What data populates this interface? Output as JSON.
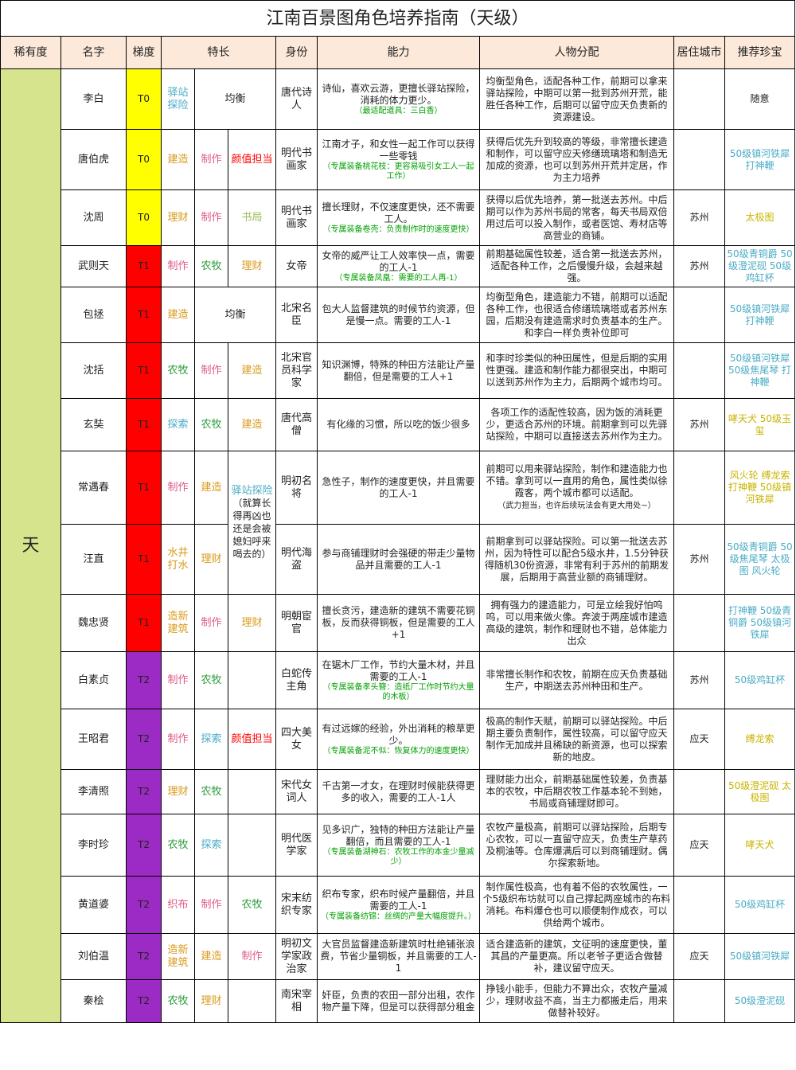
{
  "title": "江南百景图角色培养指南（天级）",
  "headers": [
    "稀有度",
    "名字",
    "梯度",
    "特长",
    "身份",
    "能力",
    "人物分配",
    "居住城市",
    "推荐珍宝"
  ],
  "rarity": "天",
  "rows": [
    {
      "name": "李白",
      "tier": "T0",
      "sp": [
        "驿站探险",
        "均衡"
      ],
      "identity": "唐代诗人",
      "ability": "诗仙，喜欢云游，更擅长驿站探险，消耗的体力更少。",
      "note": "（最适配道具：三白香）",
      "assign": "均衡型角色，适配各种工作，前期可以拿来驿站探险，中期可以第一批到苏州开荒，能胜任各种工作，后期可以留守应天负责新的资源建设。",
      "city": "",
      "treasure": "随意"
    },
    {
      "name": "唐伯虎",
      "tier": "T0",
      "sp": [
        "建造",
        "制作",
        "颜值担当"
      ],
      "identity": "明代书画家",
      "ability": "江南才子，和女性一起工作可以获得一些零钱",
      "note": "（专属装备桃花枝：更容易吸引女工人一起工作）",
      "assign": "获得后优先升到较高的等级，非常擅长建造和制作，可以留守应天修缮琉璃塔和制造无加成的资源，也可以到苏州开荒并定居，作为主力培养",
      "city": "",
      "treasure": "50级镇河铁犀 打神鞭"
    },
    {
      "name": "沈周",
      "tier": "T0",
      "sp": [
        "理财",
        "制作",
        "书局"
      ],
      "identity": "明代书画家",
      "ability": "擅长理财，不仅速度更快，还不需要工人。",
      "note": "（专属装备卷壳：负责制作时的速度更快）",
      "assign": "获得以后优先培养，第一批送去苏州。中后期可以作为苏州书局的常客，每天书局双倍用过后可以投入制作，或者医馆、寿材店等高营业的商铺。",
      "city": "苏州",
      "treasure": "太极图"
    },
    {
      "name": "武则天",
      "tier": "T1",
      "sp": [
        "制作",
        "农牧",
        "理财"
      ],
      "identity": "女帝",
      "ability": "女帝的威严让工人效率快一点，需要的工人-1",
      "note": "（专属装备凤凰：需要的工人再-1）",
      "assign": "前期基础属性较差，适合第一批送去苏州，适配各种工作，之后慢慢升级，会越来越强。",
      "city": "苏州",
      "treasure": "50级青铜爵 50级澄泥砚 50级鸡缸杯"
    },
    {
      "name": "包拯",
      "tier": "T1",
      "sp": [
        "建造",
        "均衡"
      ],
      "identity": "北宋名臣",
      "ability": "包大人监督建筑的时候节约资源，但是慢一点。需要的工人-1",
      "note": "",
      "assign": "均衡型角色，建造能力不错，前期可以适配各种工作，也很适合修缮琉璃塔或者苏州东园，后期没有建造需求时负责基本的生产。和李白一样负责补位即可",
      "city": "",
      "treasure": "50级镇河铁犀 打神鞭"
    },
    {
      "name": "沈括",
      "tier": "T1",
      "sp": [
        "农牧",
        "制作",
        "建造"
      ],
      "identity": "北宋官员科学家",
      "ability": "知识渊博，特殊的种田方法能让产量翻倍，但是需要的工人+1",
      "note": "",
      "assign": "和李时珍类似的种田属性，但是后期的实用性更强。建造和制作能力都很突出，中期可以送到苏州作为主力，后期两个城市均可。",
      "city": "",
      "treasure": "50级镇河铁犀 50级焦尾琴 打神鞭"
    },
    {
      "name": "玄奘",
      "tier": "T1",
      "sp": [
        "探索",
        "农牧",
        "建造"
      ],
      "identity": "唐代高僧",
      "ability": "有化缘的习惯，所以吃的饭少很多",
      "note": "",
      "assign": "各项工作的适配性较高，因为饭的消耗更少，更适合苏州的环境。前期拿到可以先驿站探险，中期可以直接送去苏州作为主力。",
      "city": "苏州",
      "treasure": "哮天犬 50级玉玺"
    },
    {
      "name": "常遇春",
      "tier": "T1",
      "sp": [
        "制作",
        "建造",
        "驿站探险",
        "（就算长得再凶也还是会被媳妇呼来喝去的）"
      ],
      "identity": "明初名将",
      "ability": "急性子，制作的速度更快，并且需要的工人-1",
      "note": "",
      "assign": "前期可以用来驿站探险，制作和建造能力也不错。拿到可以一直用的角色，属性类似徐霞客，两个城市都可以适配。",
      "assign_note": "（武力担当，也许后续玩法会有更大用处~）",
      "city": "",
      "treasure": "风火轮 缚龙索 打神鞭 50级镇河铁犀"
    },
    {
      "name": "汪直",
      "tier": "T1",
      "sp": [
        "水井打水",
        "理财"
      ],
      "identity": "明代海盗",
      "ability": "参与商铺理财时会强硬的带走少量物品并且需要的工人-1",
      "note": "",
      "assign": "前期拿到可以驿站探险。可以第一批送去苏州，因为特性可以配合5级水井，1.5分钟获得随机30份资源，非常有利于苏州的前期发展，后期用于高营业额的商铺理财。",
      "city": "苏州",
      "treasure": "50级青铜爵 50级焦尾琴 太极图 风火轮"
    },
    {
      "name": "魏忠贤",
      "tier": "T1",
      "sp": [
        "造新建筑",
        "制作",
        "理财"
      ],
      "identity": "明朝宦官",
      "ability": "擅长贪污，建造新的建筑不需要花铜板，反而获得铜板，但是需要的工人+1",
      "note": "",
      "assign": "拥有强力的建造能力，可是立绘我好怕呜呜，可以用来做火像。奔波于两座城市建造高级的建筑，制作和理财也不错，总体能力出众",
      "city": "",
      "treasure": "打神鞭 50级青铜爵 50级镇河铁犀"
    },
    {
      "name": "白素贞",
      "tier": "T2",
      "sp": [
        "制作",
        "农牧"
      ],
      "identity": "白蛇传主角",
      "ability": "在锯木厂工作，节约大量木材，并且需要的工人-1",
      "note": "（专属装备孝头簪：造纸厂工作时节约大量的木板）",
      "assign": "非常擅长制作和农牧，前期在应天负责基础生产，中期送去苏州种田和生产。",
      "city": "苏州",
      "treasure": "50级鸡缸杯"
    },
    {
      "name": "王昭君",
      "tier": "T2",
      "sp": [
        "制作",
        "探索",
        "颜值担当"
      ],
      "identity": "四大美女",
      "ability": "有过远嫁的经验，外出消耗的粮草更少。",
      "note": "（专属装备泥不似：恢复体力的速度更快）",
      "assign": "极高的制作天赋，前期可以驿站探险。中后期主要负责制作，属性较高，可以留守应天制作无加成并且稀缺的新资源，也可以探索新的地皮。",
      "city": "应天",
      "treasure": "缚龙索"
    },
    {
      "name": "李清照",
      "tier": "T2",
      "sp": [
        "理财",
        "农牧"
      ],
      "identity": "宋代女词人",
      "ability": "千古第一才女，在理财时候能获得更多的收入，需要的工人-1人",
      "note": "",
      "assign": "理财能力出众，前期基础属性较差，负责基本的农牧，中后期农牧工作基本轮不到她，书局或商铺理财即可。",
      "city": "",
      "treasure": "50级澄泥砚 太极图"
    },
    {
      "name": "李时珍",
      "tier": "T2",
      "sp": [
        "农牧",
        "探索"
      ],
      "identity": "明代医学家",
      "ability": "见多识广，独特的种田方法能让产量翻倍，而且需要的工人-1",
      "note": "（专属装备湖神石：农牧工作的本金少量减少）",
      "assign": "农牧产量极高，前期可以驿站探险，后期专心农牧，可以一直留守应天，负责生产草药及桐油等。仓库爆满后可以到商铺理财。偶尔探索新地。",
      "city": "应天",
      "treasure": "哮天犬"
    },
    {
      "name": "黄道婆",
      "tier": "T2",
      "sp": [
        "织布",
        "制作",
        "农牧"
      ],
      "identity": "宋末纺织专家",
      "ability": "织布专家，织布时候产量翻倍，并且需要的工人-1",
      "note": "（专属装备纺锦：丝绸的产量大幅度提升。）",
      "assign": "制作属性极高，也有着不俗的农牧属性，一个5级织布坊就可以自己撑起两座城市的布料消耗。布料爆仓也可以顺便制作成衣，可以供给两个城市。",
      "city": "",
      "treasure": "50级鸡缸杯"
    },
    {
      "name": "刘伯温",
      "tier": "T2",
      "sp": [
        "造新建筑",
        "建造",
        "制作"
      ],
      "identity": "明初文学家政治家",
      "ability": "大官员监督建造新建筑时杜绝铺张浪费，节省少量铜板，并且需要的工人-1",
      "note": "",
      "assign": "适合建造新的建筑，文征明的速度更快，董其昌的产量更高。所以老爷子更适合做替补，建议留守应天。",
      "city": "应天",
      "treasure": "50级镇河铁犀"
    },
    {
      "name": "秦桧",
      "tier": "T2",
      "sp": [
        "农牧",
        "理财"
      ],
      "identity": "南宋宰相",
      "ability": "奸臣，负责的农田一部分出租，农作物产量下降，但是可以获得部分租金",
      "note": "",
      "assign": "挣钱小能手，但能力不算出众，农牧产量减少，理财收益不高，当主力都搬走后，用来做替补较好。",
      "city": "",
      "treasure": "50级澄泥砚"
    }
  ]
}
